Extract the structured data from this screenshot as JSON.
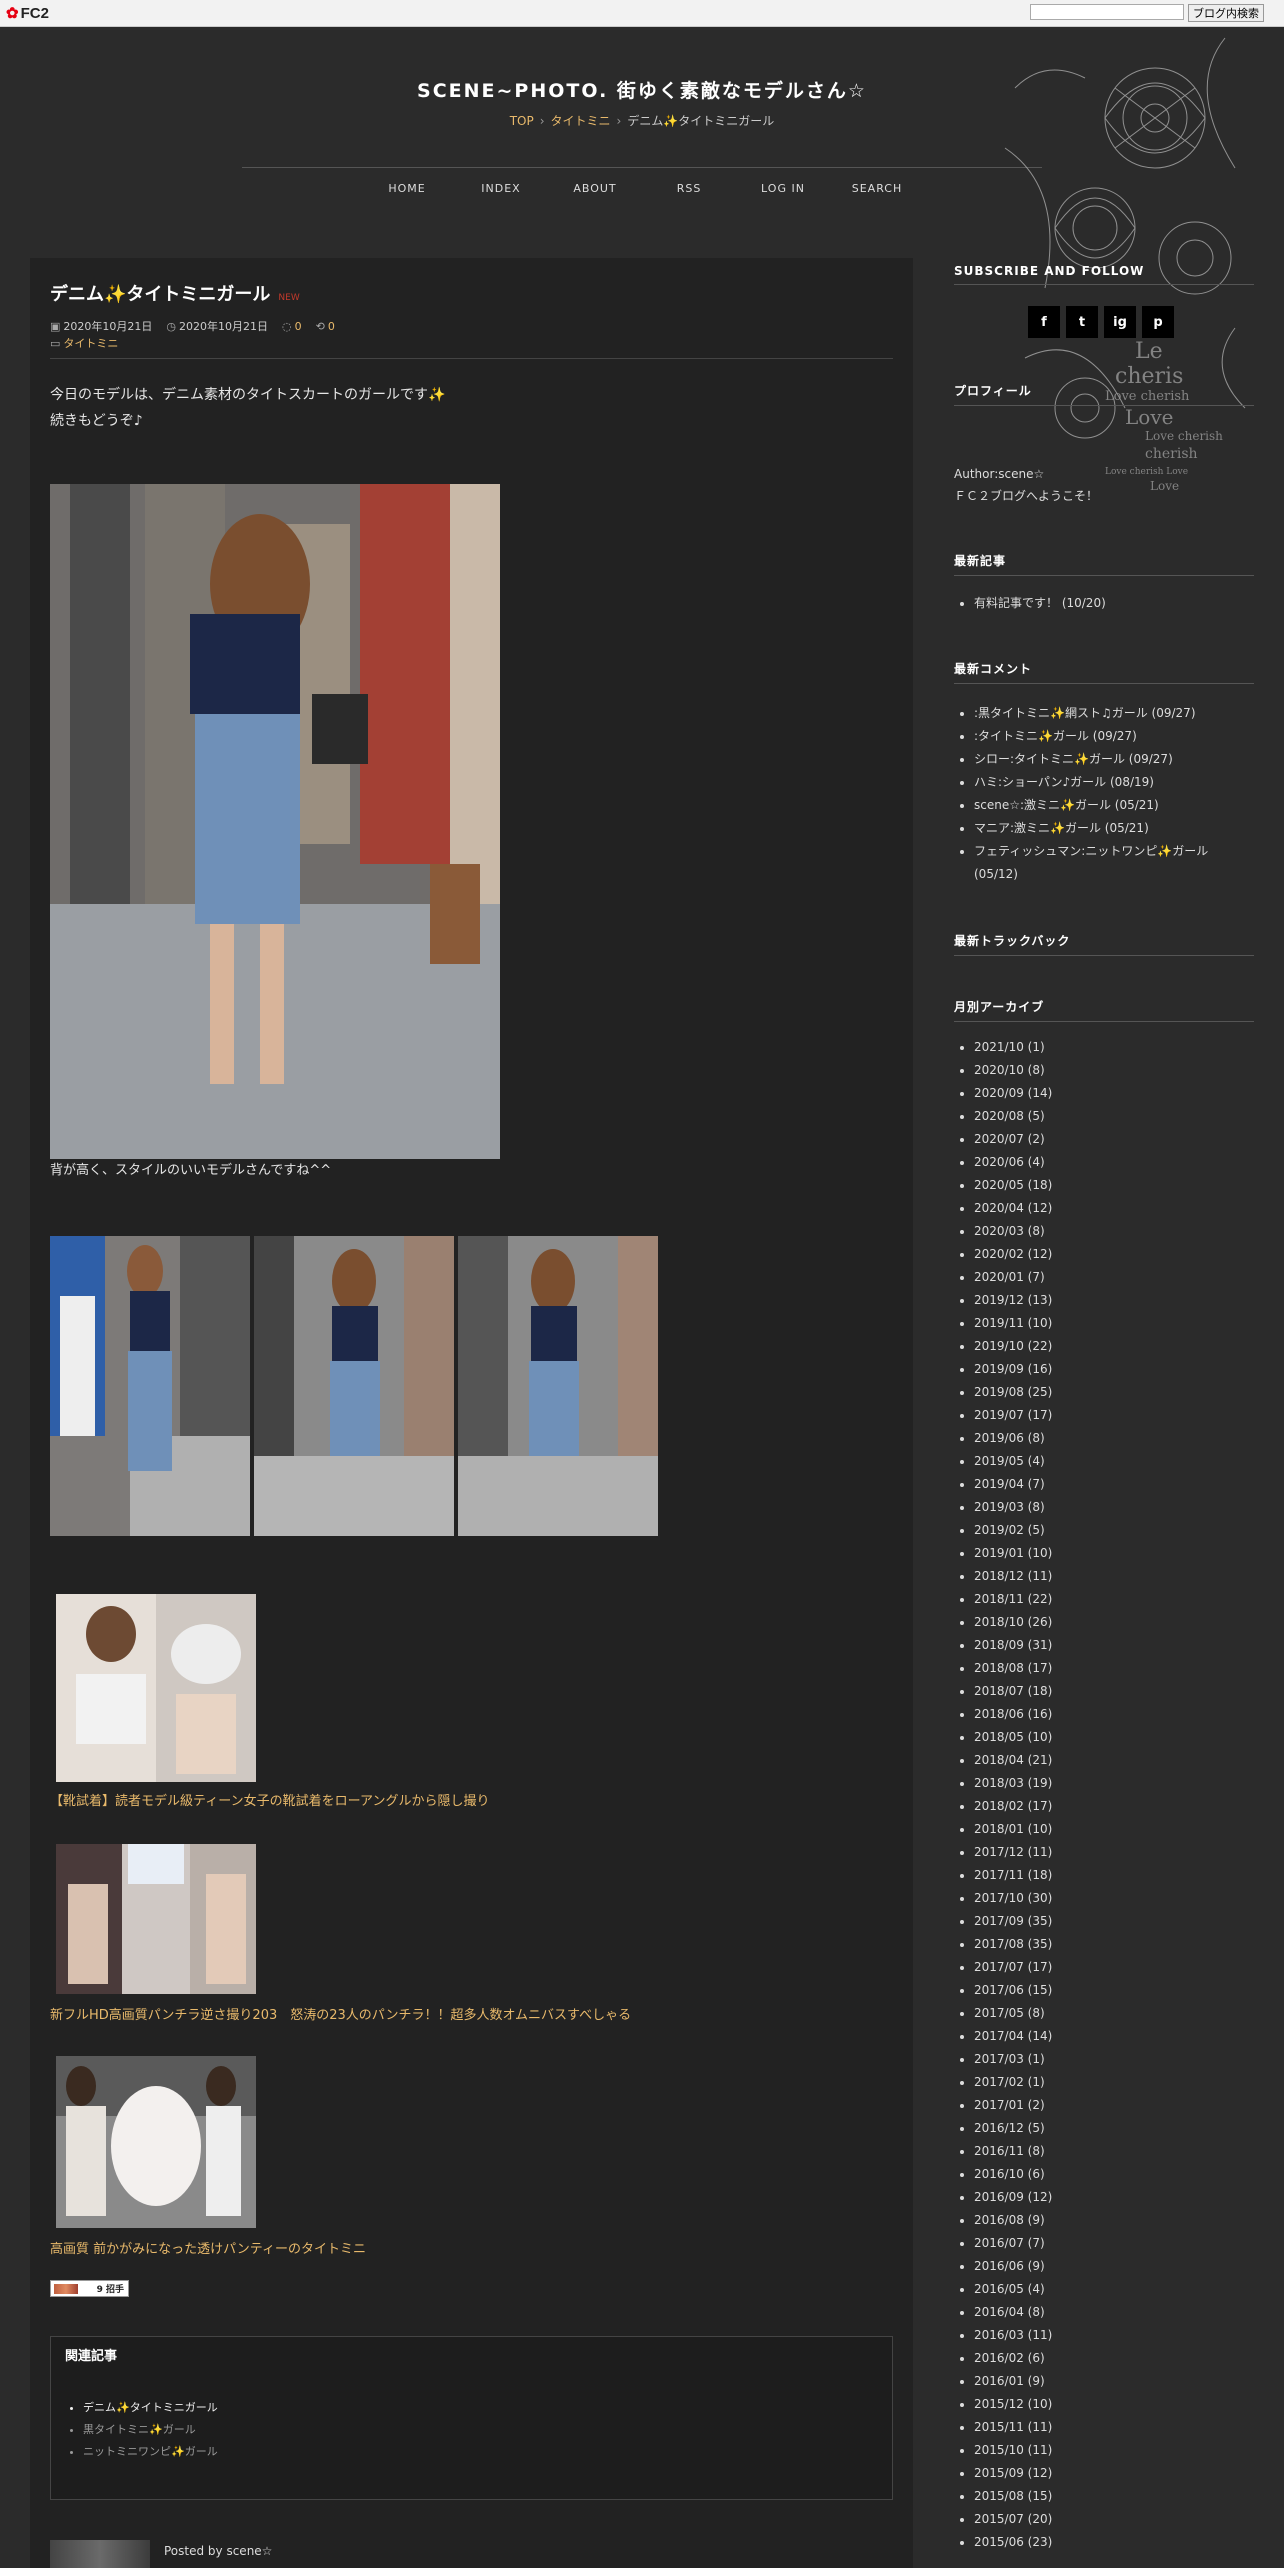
{
  "fc2": {
    "logo": "FC2",
    "search_button": "ブログ内検索"
  },
  "header": {
    "title": "SCENE~PHOTO. 街ゆく素敵なモデルさん☆",
    "breadcrumb": [
      "TOP",
      "タイトミニ",
      "デニム✨タイトミニガール"
    ]
  },
  "nav": [
    "HOME",
    "INDEX",
    "ABOUT",
    "RSS",
    "LOG IN",
    "SEARCH"
  ],
  "entry": {
    "title": "デニム✨タイトミニガール",
    "new_tag": "NEW",
    "date_posted": "2020年10月21日",
    "date_updated": "2020年10月21日",
    "comments": "0",
    "trackbacks": "0",
    "category": "タイトミニ",
    "intro1": "今日のモデルは、デニム素材のタイトスカートのガールです✨",
    "intro2": "続きもどうぞ♪",
    "caption": "背が高く、スタイルのいいモデルさんですね^^",
    "ads": [
      "【靴試着】読者モデル級ティーン女子の靴試着をローアングルから隠し撮り",
      "新フルHD高画質パンチラ逆さ撮り203　怒涛の23人のパンチラ！！超多人数オムニバスすべしゃる",
      "高画質 前かがみになった透けパンティーのタイトミニ"
    ],
    "banner_text": "9 招手"
  },
  "related": {
    "heading": "関連記事",
    "items": [
      "デニム✨タイトミニガール",
      "黒タイトミニ✨ガール",
      "ニットミニワンピ✨ガール"
    ]
  },
  "author_line": "Posted by scene☆",
  "sidebar": {
    "subscribe_heading": "SUBSCRIBE AND FOLLOW",
    "social": [
      "f",
      "t",
      "ig",
      "p"
    ],
    "profile_heading": "プロフィール",
    "author": "Author:scene☆",
    "welcome": "ＦＣ２ブログへようこそ！",
    "recent_heading": "最新記事",
    "recent": [
      "有料記事です！ (10/20)"
    ],
    "comments_heading": "最新コメント",
    "comments": [
      ":黒タイトミニ✨網スト♫ガール (09/27)",
      ":タイトミニ✨ガール (09/27)",
      "シロー:タイトミニ✨ガール (09/27)",
      "ハミ:ショーパン♪ガール (08/19)",
      "scene☆:激ミニ✨ガール (05/21)",
      "マニア:激ミニ✨ガール (05/21)",
      "フェティッシュマン:ニットワンピ✨ガール (05/12)"
    ],
    "trackback_heading": "最新トラックバック",
    "archive_heading": "月別アーカイブ",
    "archive": [
      "2021/10 (1)",
      "2020/10 (8)",
      "2020/09 (14)",
      "2020/08 (5)",
      "2020/07 (2)",
      "2020/06 (4)",
      "2020/05 (18)",
      "2020/04 (12)",
      "2020/03 (8)",
      "2020/02 (12)",
      "2020/01 (7)",
      "2019/12 (13)",
      "2019/11 (10)",
      "2019/10 (22)",
      "2019/09 (16)",
      "2019/08 (25)",
      "2019/07 (17)",
      "2019/06 (8)",
      "2019/05 (4)",
      "2019/04 (7)",
      "2019/03 (8)",
      "2019/02 (5)",
      "2019/01 (10)",
      "2018/12 (11)",
      "2018/11 (22)",
      "2018/10 (26)",
      "2018/09 (31)",
      "2018/08 (17)",
      "2018/07 (18)",
      "2018/06 (16)",
      "2018/05 (10)",
      "2018/04 (21)",
      "2018/03 (19)",
      "2018/02 (17)",
      "2018/01 (10)",
      "2017/12 (11)",
      "2017/11 (18)",
      "2017/10 (30)",
      "2017/09 (35)",
      "2017/08 (35)",
      "2017/07 (17)",
      "2017/06 (15)",
      "2017/05 (8)",
      "2017/04 (14)",
      "2017/03 (1)",
      "2017/02 (1)",
      "2017/01 (2)",
      "2016/12 (5)",
      "2016/11 (8)",
      "2016/10 (6)",
      "2016/09 (12)",
      "2016/08 (9)",
      "2016/07 (7)",
      "2016/06 (9)",
      "2016/05 (4)",
      "2016/04 (8)",
      "2016/03 (11)",
      "2016/02 (6)",
      "2016/01 (9)",
      "2015/12 (10)",
      "2015/11 (11)",
      "2015/10 (11)",
      "2015/09 (12)",
      "2015/08 (15)",
      "2015/07 (20)",
      "2015/06 (23)"
    ]
  }
}
